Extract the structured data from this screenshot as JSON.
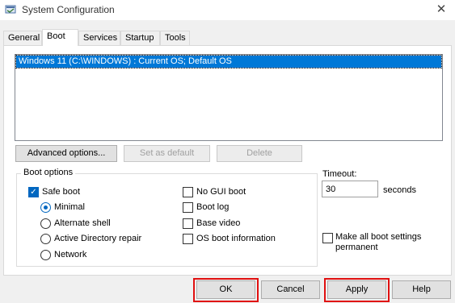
{
  "window": {
    "title": "System Configuration",
    "close_glyph": "✕",
    "icon": "msconfig-icon"
  },
  "tabs": [
    {
      "label": "General"
    },
    {
      "label": "Boot"
    },
    {
      "label": "Services"
    },
    {
      "label": "Startup"
    },
    {
      "label": "Tools"
    }
  ],
  "active_tab": "Boot",
  "os_list": {
    "items": [
      "Windows 11 (C:\\WINDOWS) : Current OS; Default OS"
    ],
    "selected_index": 0
  },
  "list_buttons": {
    "advanced": "Advanced options...",
    "set_default": "Set as default",
    "delete": "Delete"
  },
  "boot_options": {
    "title": "Boot options",
    "safe_boot": {
      "label": "Safe boot",
      "checked": true
    },
    "safe_modes": [
      {
        "label": "Minimal",
        "selected": true
      },
      {
        "label": "Alternate shell",
        "selected": false
      },
      {
        "label": "Active Directory repair",
        "selected": false
      },
      {
        "label": "Network",
        "selected": false
      }
    ],
    "right_options": [
      {
        "label": "No GUI boot",
        "checked": false
      },
      {
        "label": "Boot log",
        "checked": false
      },
      {
        "label": "Base video",
        "checked": false
      },
      {
        "label": "OS boot information",
        "checked": false
      }
    ]
  },
  "timeout": {
    "label": "Timeout:",
    "value": "30",
    "unit": "seconds"
  },
  "persistent": {
    "label": "Make all boot settings permanent",
    "checked": false
  },
  "footer_buttons": {
    "ok": "OK",
    "cancel": "Cancel",
    "apply": "Apply",
    "help": "Help"
  },
  "colors": {
    "selection": "#0078d7",
    "checkbox_accent": "#0067c0",
    "highlight_border": "#e01010"
  }
}
